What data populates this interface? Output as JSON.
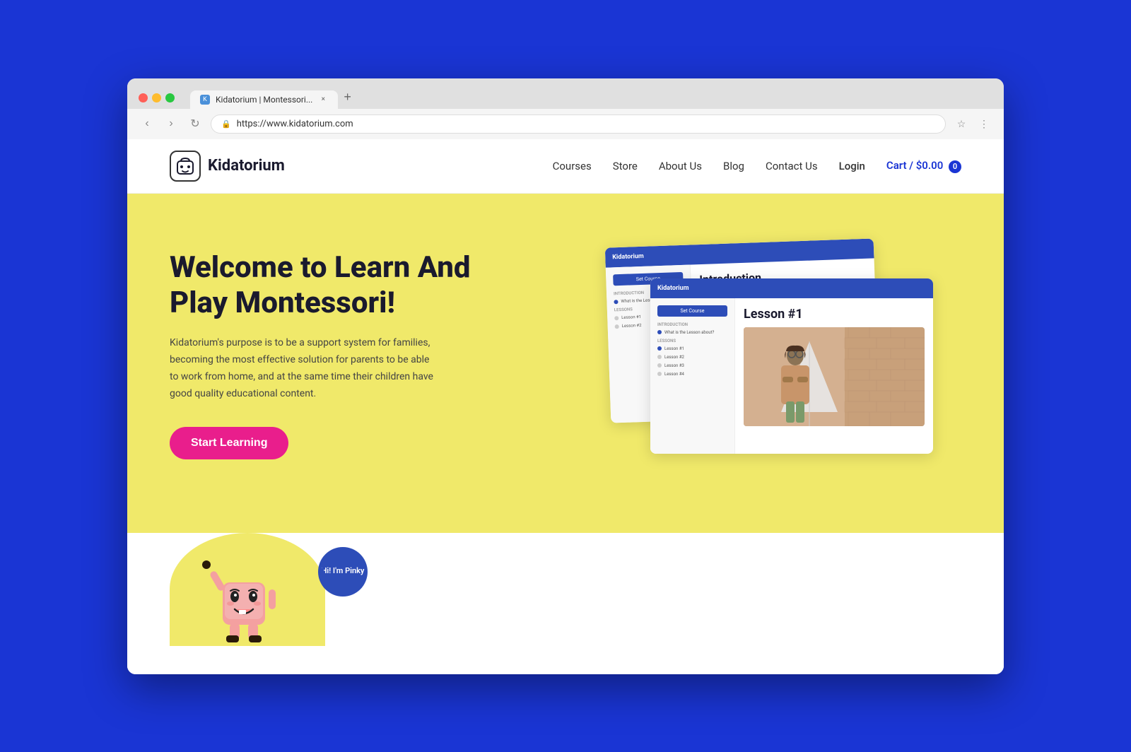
{
  "browser": {
    "url": "https://www.kidatorium.com",
    "tab_title": "Kidatorium | Montessori...",
    "tab_close": "×",
    "tab_new": "+",
    "nav_back": "‹",
    "nav_forward": "›",
    "nav_refresh": "↻"
  },
  "site": {
    "logo_text": "Kidatorium",
    "nav": {
      "courses": "Courses",
      "store": "Store",
      "about": "About Us",
      "blog": "Blog",
      "contact": "Contact Us",
      "login": "Login",
      "cart": "Cart / $0.00",
      "cart_count": "0"
    },
    "hero": {
      "title": "Welcome to Learn And Play Montessori!",
      "description": "Kidatorium's purpose is to be a support system for families, becoming the most effective solution for parents to be able to work from home, and at the same time their children have good quality educational content.",
      "cta_button": "Start Learning"
    },
    "cards": {
      "card1_title": "Introduction",
      "card2_title": "Lesson #1",
      "kidatorium_label": "Kidatorium",
      "set_course": "Set Course",
      "introduction_section": "Introduction",
      "what_is": "What is the Lesson about?",
      "lessons_section": "Lessons",
      "lesson1": "Lesson #1",
      "lesson2": "Lesson #2",
      "lesson3": "Lesson #3",
      "lesson4": "Lesson #4"
    },
    "mascot": {
      "name": "Pinky",
      "speech": "Hi! I'm Pinky"
    }
  }
}
